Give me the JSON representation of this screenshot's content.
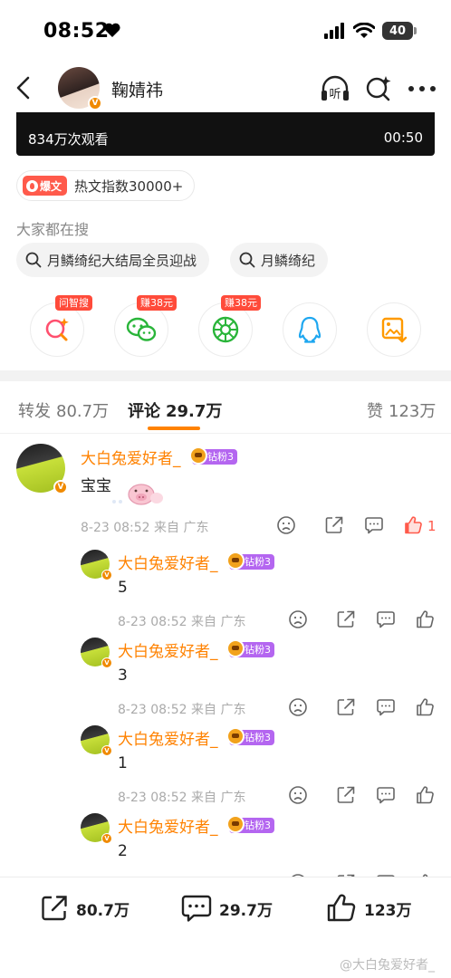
{
  "status_bar": {
    "time": "08:52",
    "battery": "40"
  },
  "header": {
    "name": "鞠婧祎"
  },
  "video": {
    "views": "834万次观看",
    "duration": "00:50"
  },
  "hot": {
    "tag": "爆文",
    "text": "热文指数30000+"
  },
  "search": {
    "title": "大家都在搜",
    "chips": [
      "月鳞绮纪大结局全员迎战",
      "月鳞绮纪"
    ]
  },
  "apps": [
    {
      "name": "search-app",
      "tag": "问智搜"
    },
    {
      "name": "wechat",
      "tag": "赚38元"
    },
    {
      "name": "moments",
      "tag": "赚38元"
    },
    {
      "name": "qq",
      "tag": ""
    },
    {
      "name": "save-image",
      "tag": ""
    }
  ],
  "tabs": {
    "repost_label": "转发",
    "repost_count": "80.7万",
    "comment_label": "评论",
    "comment_count": "29.7万",
    "like_label": "赞",
    "like_count": "123万"
  },
  "comments": [
    {
      "user": "大白兔爱好者_",
      "badge": "钻粉3",
      "text": "宝宝",
      "meta": "8-23 08:52 来自 广东",
      "likes": "1"
    }
  ],
  "replies": [
    {
      "user": "大白兔爱好者_",
      "badge": "钻粉3",
      "text": "5",
      "meta": "8-23 08:52 来自 广东"
    },
    {
      "user": "大白兔爱好者_",
      "badge": "钻粉3",
      "text": "3",
      "meta": "8-23 08:52 来自 广东"
    },
    {
      "user": "大白兔爱好者_",
      "badge": "钻粉3",
      "text": "1",
      "meta": "8-23 08:52 来自 广东"
    },
    {
      "user": "大白兔爱好者_",
      "badge": "钻粉3",
      "text": "2",
      "meta": "8-23 08:52 来自 广东"
    }
  ],
  "bottom_bar": {
    "repost": "80.7万",
    "comment": "29.7万",
    "like": "123万",
    "watermark": "@大白兔爱好者_"
  },
  "colors": {
    "accent": "#ff8200",
    "like": "#ff5a4b",
    "badge": "#b466f0",
    "tag": "#ff4b3a"
  },
  "icons": [
    "back-icon",
    "headphones-icon",
    "ai-search-icon",
    "more-icon",
    "dislike-icon",
    "share-icon",
    "comment-icon",
    "like-icon"
  ]
}
